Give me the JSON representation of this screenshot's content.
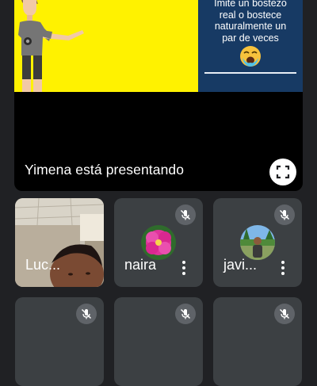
{
  "presentation": {
    "slide_text": "Imite un bostezo\nreal o bostece\nnaturalmente un\npar de veces",
    "presenting_label": "Yimena está presentando",
    "fullscreen_icon": "fullscreen-icon",
    "colors": {
      "slide_yellow": "#fff200",
      "slide_panel": "#173a64"
    }
  },
  "participants": [
    {
      "name": "Luc...",
      "muted": false,
      "has_video": true
    },
    {
      "name": "naira",
      "muted": true,
      "has_video": false,
      "avatar": "pink-flower-avatar"
    },
    {
      "name": "javi...",
      "muted": true,
      "has_video": false,
      "avatar": "outdoor-photo-avatar"
    },
    {
      "name": "",
      "muted": true
    },
    {
      "name": "",
      "muted": true
    },
    {
      "name": "",
      "muted": true
    }
  ],
  "icons": {
    "mute": "mic-off-icon",
    "more": "more-vert-icon"
  }
}
